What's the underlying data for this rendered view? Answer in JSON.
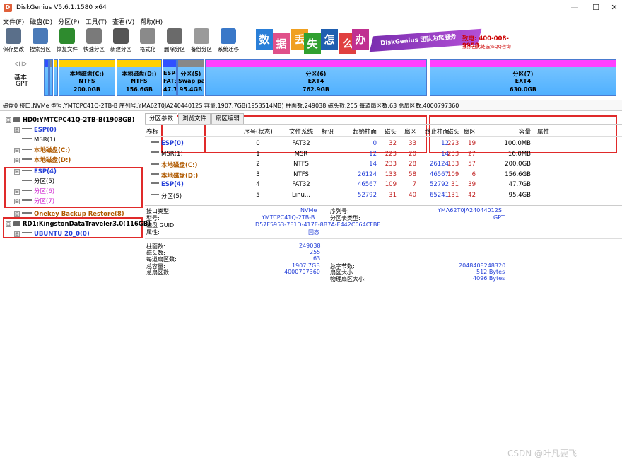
{
  "window": {
    "title": "DiskGenius V5.6.1.1580 x64",
    "app_icon_letter": "D",
    "minimize": "—",
    "maximize": "☐",
    "close": "✕"
  },
  "menu": [
    "文件(F)",
    "磁盘(D)",
    "分区(P)",
    "工具(T)",
    "查看(V)",
    "帮助(H)"
  ],
  "toolbar": {
    "buttons": [
      {
        "label": "保存更改",
        "icon": "save-icon",
        "color": "#5a6f8a"
      },
      {
        "label": "搜索分区",
        "icon": "search-icon",
        "color": "#4a7ab8"
      },
      {
        "label": "恢复文件",
        "icon": "recover-icon",
        "color": "#2e8b2e"
      },
      {
        "label": "快速分区",
        "icon": "quick-partition-icon",
        "color": "#7a7a7a"
      },
      {
        "label": "新建分区",
        "icon": "new-partition-icon",
        "color": "#555555"
      },
      {
        "label": "格式化",
        "icon": "format-icon",
        "color": "#8a8a8a"
      },
      {
        "label": "删除分区",
        "icon": "delete-icon",
        "color": "#6a6a6a"
      },
      {
        "label": "备份分区",
        "icon": "backup-icon",
        "color": "#9a9a9a"
      },
      {
        "label": "系统迁移",
        "icon": "migrate-icon",
        "color": "#3a78c8"
      }
    ],
    "ad": {
      "tiles": [
        {
          "char": "数",
          "color": "#2a7fd8"
        },
        {
          "char": "据",
          "color": "#e0508a"
        },
        {
          "char": "丢",
          "color": "#f0a020"
        },
        {
          "char": "失",
          "color": "#30a030"
        },
        {
          "char": "怎",
          "color": "#1f5fb0"
        },
        {
          "char": "么",
          "color": "#e04040"
        },
        {
          "char": "办",
          "color": "#c03090"
        }
      ],
      "slogan": "DiskGenius 团队为您服务",
      "phone": "致电: 400-008-9958",
      "sub": "或点击此处选择QQ咨询"
    }
  },
  "disk_map": {
    "nav": "◁ ▷",
    "type_label_1": "基本",
    "type_label_2": "GPT",
    "segments": [
      {
        "name": "本地磁盘(C:)",
        "fs": "NTFS",
        "size": "200.0GB",
        "top_color": "#ffd000"
      },
      {
        "name": "本地磁盘(D:)",
        "fs": "NTFS",
        "size": "156.6GB",
        "top_color": "#ffd000"
      },
      {
        "name": "ESP(4)",
        "fs": "FAT32",
        "size": "47.7GB",
        "top_color": "#3050ff"
      },
      {
        "name": "分区(5)",
        "fs": "Swap pa",
        "size": "95.4GB",
        "top_color": "#888888"
      },
      {
        "name": "分区(6)",
        "fs": "EXT4",
        "size": "762.9GB",
        "top_color": "#ff40ff"
      },
      {
        "name": "分区(7)",
        "fs": "EXT4",
        "size": "630.0GB",
        "top_color": "#ff40ff"
      }
    ]
  },
  "info_line": "磁盘0 接口:NVMe  型号:YMTCPC41Q-2TB-B  序列号:YMA62T0JA24044012S  容量:1907.7GB(1953514MB)  柱面数:249038  磁头数:255  每道扇区数:63  总扇区数:4000797360",
  "tree": [
    {
      "text": "HD0:YMTCPC41Q-2TB-B(1908GB)",
      "style": "c-black",
      "kind": "disk",
      "expander": "⊟"
    },
    {
      "text": "ESP(0)",
      "style": "c-blue",
      "kind": "part",
      "expander": "⊞"
    },
    {
      "text": "MSR(1)",
      "style": "c-dark",
      "kind": "part",
      "expander": ""
    },
    {
      "text": "本地磁盘(C:)",
      "style": "c-brown",
      "kind": "part",
      "expander": "⊞"
    },
    {
      "text": "本地磁盘(D:)",
      "style": "c-brown",
      "kind": "part",
      "expander": "⊞"
    },
    {
      "text": "ESP(4)",
      "style": "c-blue",
      "kind": "part",
      "expander": "⊞"
    },
    {
      "text": "分区(5)",
      "style": "c-dark",
      "kind": "part",
      "expander": ""
    },
    {
      "text": "分区(6)",
      "style": "c-magenta",
      "kind": "part",
      "expander": "⊞"
    },
    {
      "text": "分区(7)",
      "style": "c-magenta",
      "kind": "part",
      "expander": "⊞"
    },
    {
      "text": "Onekey Backup Restore(8)",
      "style": "c-brown",
      "kind": "part",
      "expander": "⊞"
    },
    {
      "text": "RD1:KingstonDataTraveler3.0(116GB)",
      "style": "c-black",
      "kind": "disk",
      "expander": "⊟"
    },
    {
      "text": "UBUNTU 20_0(0)",
      "style": "c-blue",
      "kind": "part",
      "expander": "⊞"
    }
  ],
  "tabs": [
    "分区参数",
    "浏览文件",
    "扇区编辑"
  ],
  "table": {
    "headers": [
      "卷标",
      "序号(状态)",
      "文件系统",
      "标识",
      "起始柱面",
      "磁头",
      "扇区",
      "终止柱面",
      "磁头",
      "扇区",
      "容量",
      "属性"
    ],
    "rows": [
      {
        "label": "ESP(0)",
        "style": "c-blue",
        "cells": [
          "0",
          "FAT32",
          "",
          "0",
          "32",
          "33",
          "12",
          "223",
          "19",
          "100.0MB",
          ""
        ]
      },
      {
        "label": "MSR(1)",
        "style": "c-dark",
        "cells": [
          "1",
          "MSR",
          "",
          "12",
          "223",
          "20",
          "14",
          "233",
          "27",
          "16.0MB",
          ""
        ]
      },
      {
        "label": "本地磁盘(C:)",
        "style": "c-brown",
        "cells": [
          "2",
          "NTFS",
          "",
          "14",
          "233",
          "28",
          "26124",
          "133",
          "57",
          "200.0GB",
          ""
        ]
      },
      {
        "label": "本地磁盘(D:)",
        "style": "c-brown",
        "cells": [
          "3",
          "NTFS",
          "",
          "26124",
          "133",
          "58",
          "46567",
          "109",
          "6",
          "156.6GB",
          ""
        ]
      },
      {
        "label": "ESP(4)",
        "style": "c-blue",
        "cells": [
          "4",
          "FAT32",
          "",
          "46567",
          "109",
          "7",
          "52792",
          "31",
          "39",
          "47.7GB",
          ""
        ]
      },
      {
        "label": "分区(5)",
        "style": "c-dark",
        "cells": [
          "5",
          "Linu...",
          "",
          "52792",
          "31",
          "40",
          "65241",
          "131",
          "42",
          "95.4GB",
          ""
        ]
      }
    ]
  },
  "details": {
    "iface_label": "接口类型:",
    "iface_value": "NVMe",
    "serial_label": "序列号:",
    "serial_value": "YMA62T0JA24044012S",
    "model_label": "型号:",
    "model_value": "YMTCPC41Q-2TB-B",
    "ptype_label": "分区表类型:",
    "ptype_value": "GPT",
    "guid_label": "磁盘 GUID:",
    "guid_value": "D57F5953-7E1D-417E-8B7A-E442C064CFBE",
    "attr_label": "属性:",
    "attr_value": "固态",
    "cyl_label": "柱面数:",
    "cyl_value": "249038",
    "heads_label": "磁头数:",
    "heads_value": "255",
    "spt_label": "每道扇区数:",
    "spt_value": "63",
    "cap_label": "总容量:",
    "cap_value": "1907.7GB",
    "bytes_label": "总字节数:",
    "bytes_value": "2048408248320",
    "sectors_label": "总扇区数:",
    "sectors_value": "4000797360",
    "secsize_label": "扇区大小:",
    "secsize_value": "512 Bytes",
    "physsec_label": "物理扇区大小:",
    "physsec_value": "4096 Bytes"
  },
  "watermark": "CSDN @叶凡要飞"
}
